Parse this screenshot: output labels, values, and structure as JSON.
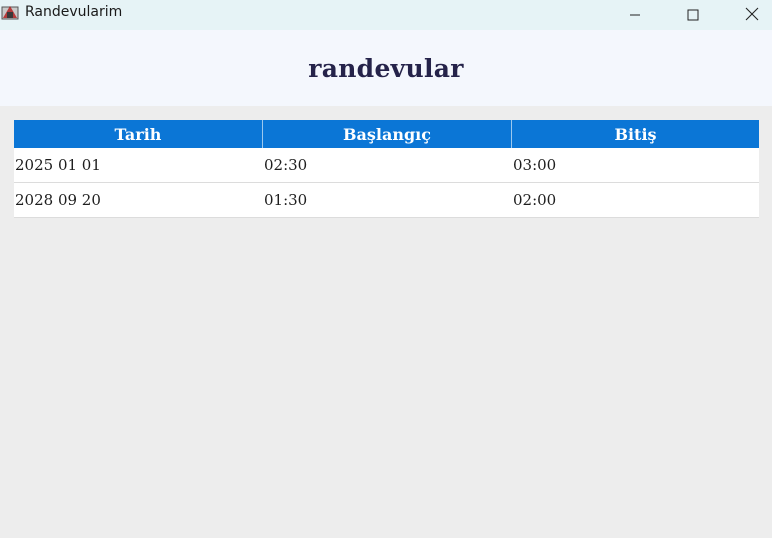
{
  "window": {
    "title": "Randevularim",
    "icons": {
      "app": "app-icon",
      "minimize": "minimize-icon",
      "maximize": "maximize-icon",
      "close": "close-icon"
    }
  },
  "header": {
    "title": "randevular"
  },
  "table": {
    "columns": [
      "Tarih",
      "Başlangıç",
      "Bitiş"
    ],
    "rows": [
      [
        "2025 01 01",
        "02:30",
        "03:00"
      ],
      [
        "2028 09 20",
        "01:30",
        "02:00"
      ]
    ]
  },
  "colors": {
    "header_accent": "#0b76d6",
    "title_color": "#25234a",
    "titlebar_bg": "#e6f3f6",
    "body_bg": "#ededed"
  }
}
